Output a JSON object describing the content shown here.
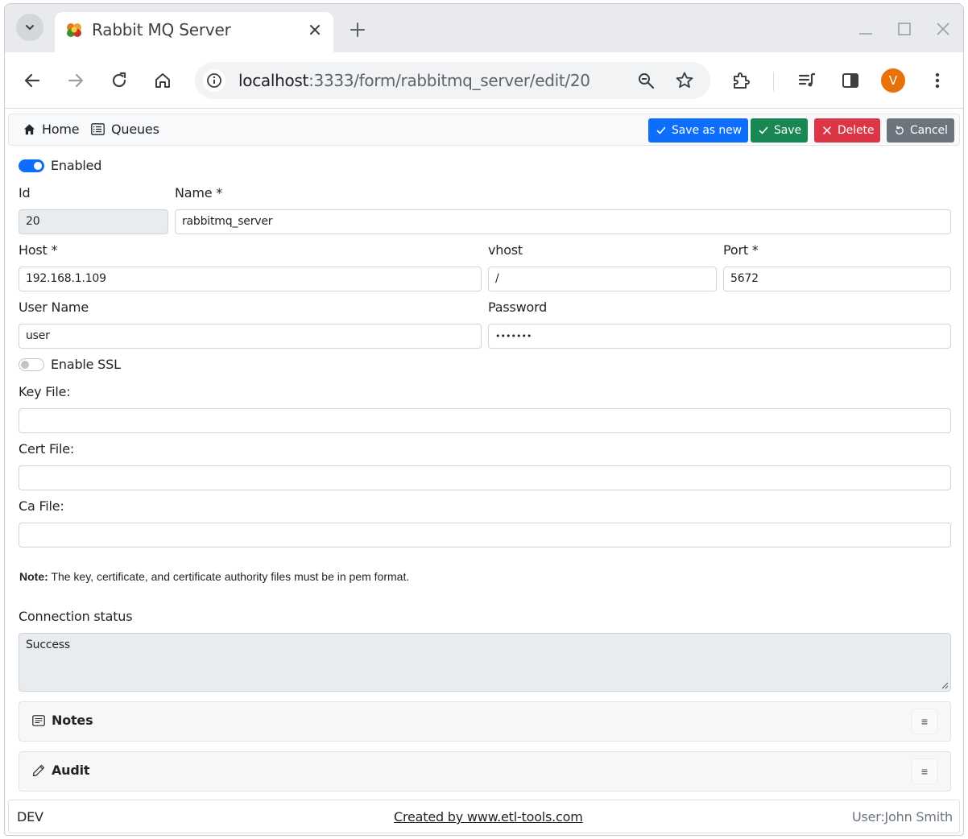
{
  "browser": {
    "tab_title": "Rabbit MQ Server",
    "url_host": "localhost",
    "url_path": ":3333/form/rabbitmq_server/edit/20",
    "profile_initial": "V"
  },
  "nav": {
    "home_label": "Home",
    "queues_label": "Queues"
  },
  "actions": {
    "save_as_new": "Save as new",
    "save": "Save",
    "delete": "Delete",
    "cancel": "Cancel"
  },
  "form": {
    "enabled_label": "Enabled",
    "enabled": true,
    "id_label": "Id",
    "id_value": "20",
    "name_label": "Name *",
    "name_value": "rabbitmq_server",
    "host_label": "Host *",
    "host_value": "192.168.1.109",
    "vhost_label": "vhost",
    "vhost_value": "/",
    "port_label": "Port *",
    "port_value": "5672",
    "username_label": "User Name",
    "username_value": "user",
    "password_label": "Password",
    "password_value": "•••••••",
    "ssl_label": "Enable SSL",
    "ssl_enabled": false,
    "keyfile_label": "Key File:",
    "keyfile_value": "",
    "certfile_label": "Cert File:",
    "certfile_value": "",
    "cafile_label": "Ca File:",
    "cafile_value": "",
    "note_bold": "Note:",
    "note_text": " The key, certificate, and certificate authority files must be in pem format.",
    "status_label": "Connection status",
    "status_value": "Success"
  },
  "panels": {
    "notes_title": "Notes",
    "audit_title": "Audit",
    "toggle_glyph": "≡"
  },
  "footer": {
    "env": "DEV",
    "credit": "Created by www.etl-tools.com",
    "user": "User:John Smith"
  },
  "colors": {
    "primary": "#0d6efd",
    "success": "#198754",
    "danger": "#dc3545",
    "secondary": "#6c757d",
    "profile": "#e8710a"
  }
}
